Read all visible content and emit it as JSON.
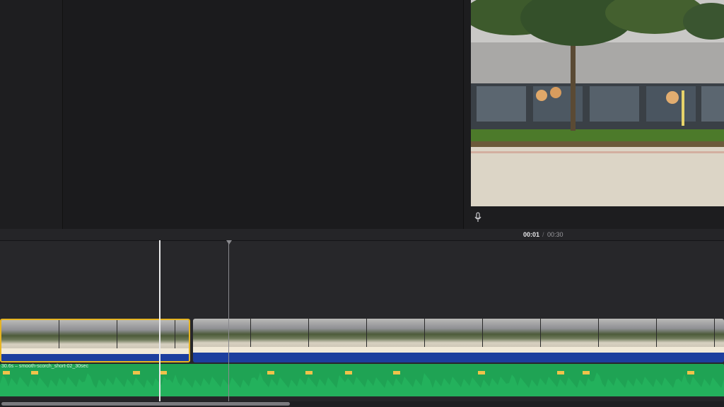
{
  "viewer": {
    "mic_icon": "microphone-icon"
  },
  "timecode": {
    "current": "00:01",
    "separator": "/",
    "total": "00:30"
  },
  "audio": {
    "label": "30.6s – smooth-scorch_short-02_30sec"
  },
  "colors": {
    "selection": "#e6b422",
    "audio": "#1fa354",
    "audio_peak": "#f0c24a",
    "video_strip": "#1d3f9e"
  }
}
